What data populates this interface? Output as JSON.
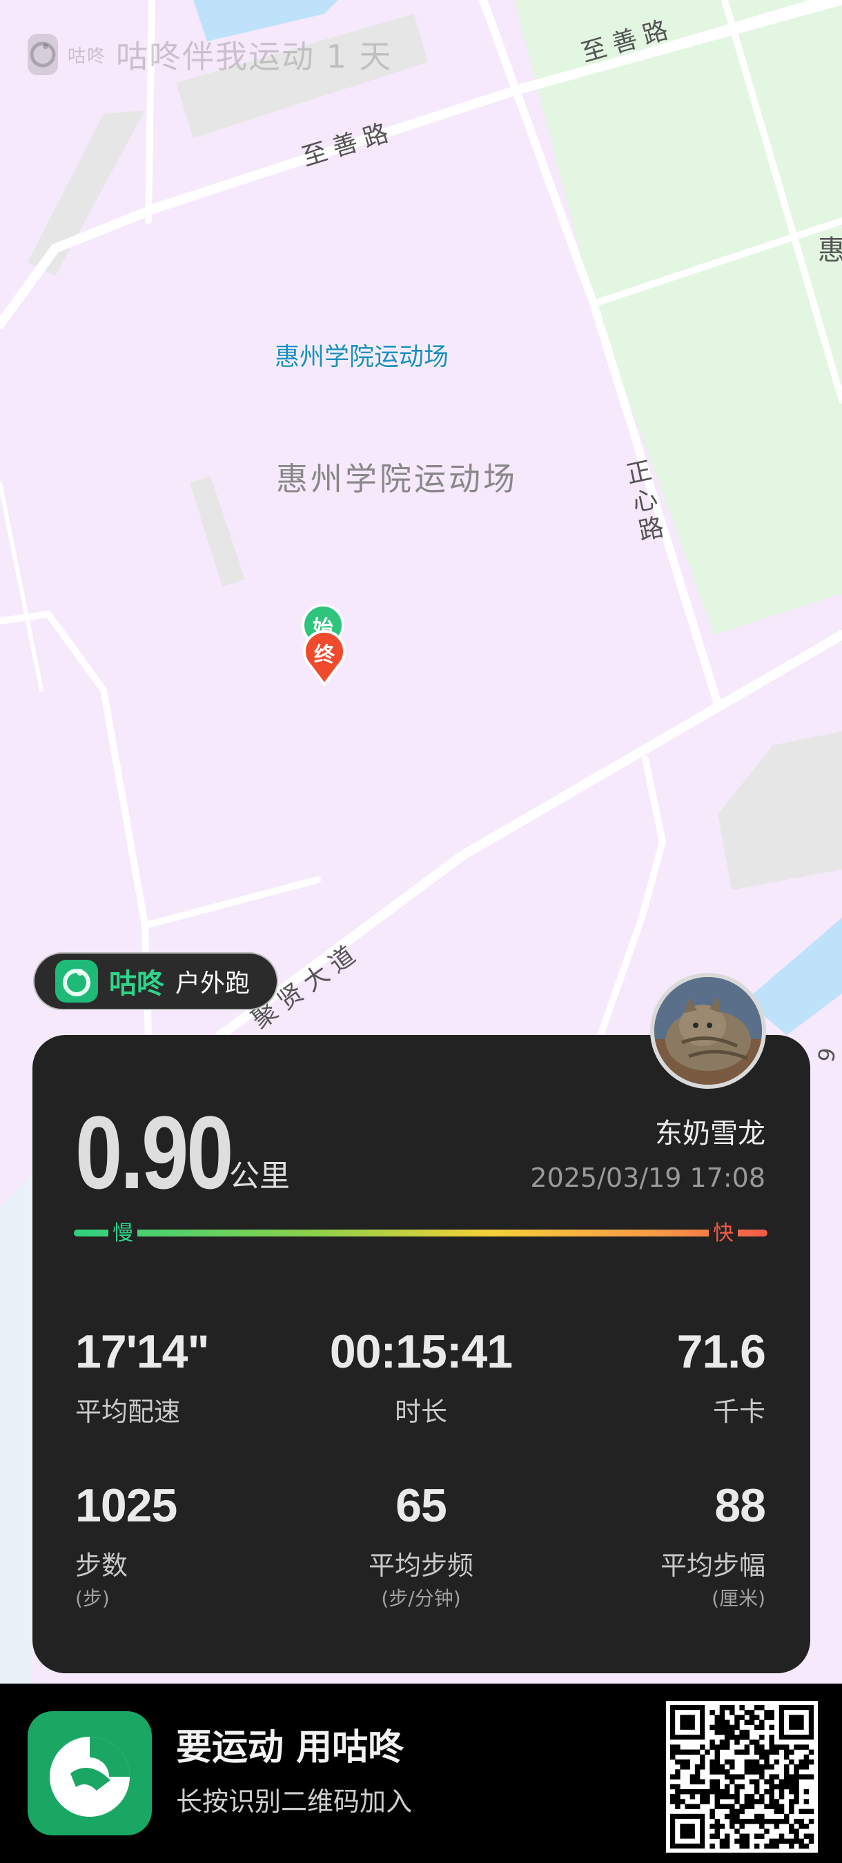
{
  "watermark": {
    "logo_text": "咕咚",
    "text": "咕咚伴我运动 1 天"
  },
  "map": {
    "labels": {
      "road_zhishan_1": "至善路",
      "road_zhishan_2": "至善路",
      "road_zhengxin": "正心路",
      "road_juxian": "聚贤大道",
      "poi_blue": "惠州学院运动场",
      "poi_gray": "惠州学院运动场",
      "edge_hui": "惠",
      "edge_num": "9"
    },
    "markers": {
      "start": "始",
      "end": "终"
    },
    "colors": {
      "campus": "#f6e9fb",
      "green_area": "#e2f6e1",
      "water": "#bfe2fb",
      "road": "#ffffff",
      "gray_block": "#e6e6e6"
    }
  },
  "activity": {
    "brand": "咕咚",
    "type": "户外跑"
  },
  "summary": {
    "distance": "0.90",
    "distance_unit": "公里",
    "user_name": "东奶雪龙",
    "datetime": "2025/03/19 17:08",
    "pace_slow": "慢",
    "pace_fast": "快"
  },
  "metrics": [
    {
      "value": "17'14\"",
      "label": "平均配速",
      "unit": ""
    },
    {
      "value": "00:15:41",
      "label": "时长",
      "unit": ""
    },
    {
      "value": "71.6",
      "label": "千卡",
      "unit": ""
    },
    {
      "value": "1025",
      "label": "步数",
      "unit": "(步)"
    },
    {
      "value": "65",
      "label": "平均步频",
      "unit": "(步/分钟)"
    },
    {
      "value": "88",
      "label": "平均步幅",
      "unit": "(厘米)"
    }
  ],
  "footer": {
    "slogan": "要运动 用咕咚",
    "subline": "长按识别二维码加入"
  },
  "colors": {
    "accent_green": "#2ed48a",
    "card_bg": "#222222",
    "footer_bg": "#000000",
    "marker_start": "#2ec47c",
    "marker_end": "#f04a2c"
  }
}
